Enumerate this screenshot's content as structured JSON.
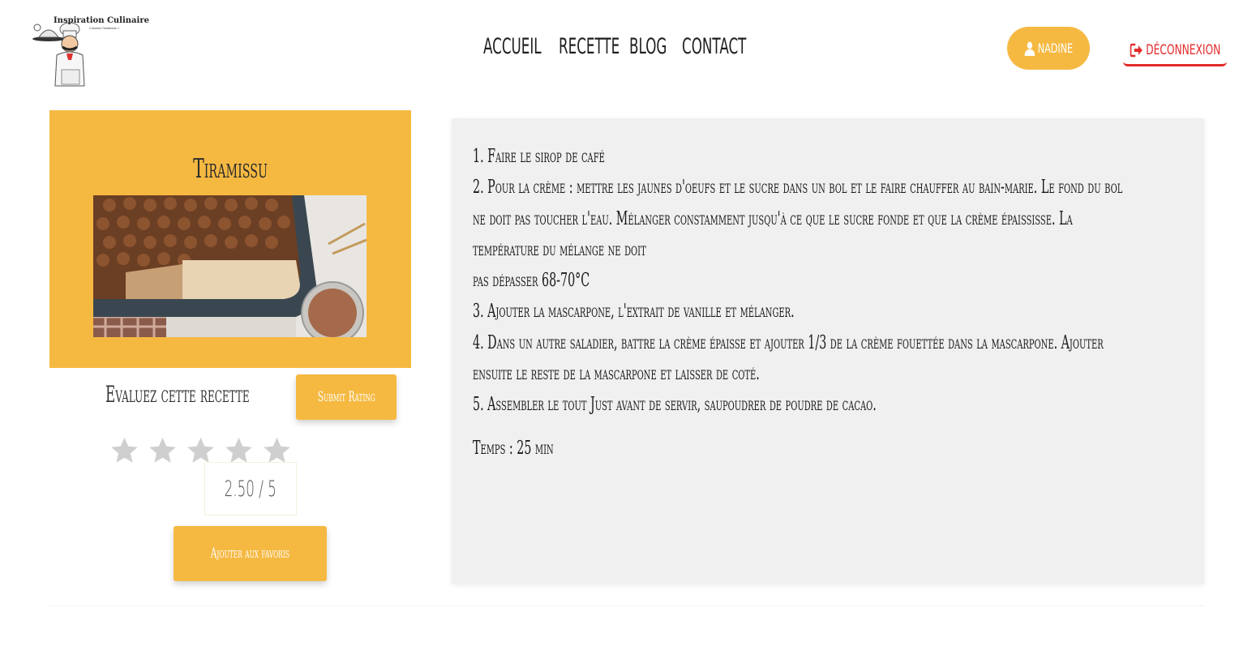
{
  "brand": {
    "name": "Inspiration Culinaire",
    "tagline": "Cuisinez l'inattendu !"
  },
  "nav": {
    "items": [
      {
        "label": "ACCUEIL"
      },
      {
        "label": "RECETTE"
      },
      {
        "label": "BLOG"
      },
      {
        "label": "CONTACT"
      }
    ]
  },
  "user": {
    "name": "NADINE",
    "logout_label": "DÉCONNEXION"
  },
  "recipe": {
    "title": "Tiramissu",
    "rate_prompt": "Evaluez cette recette",
    "submit_label": "Submit Rating",
    "rating": {
      "value": 2.5,
      "max": 5,
      "display": "2.50 / 5"
    },
    "favorite_label": "Ajouter aux favoris",
    "steps": [
      "1. Faire le sirop de café",
      "2. Pour la crème : mettre les jaunes d'oeufs et le sucre dans un bol et le faire chauffer au bain-marie. Le fond du bol",
      "ne doit pas toucher l'eau. Mélanger constamment jusqu'à ce que le sucre fonde et que la crème épaississe. La",
      "température du mélange ne doit",
      "pas dépasser 68-70°C",
      "3. Ajouter la mascarpone, l'extrait de vanille et mélanger.",
      "4. Dans un autre saladier, battre la crème épaisse et ajouter 1/3 de la crème fouettée dans la mascarpone. Ajouter",
      "ensuite le reste de la mascarpone et laisser de coté.",
      "5. Assembler le tout Just avant de servir, saupoudrer de poudre de cacao."
    ],
    "time": "Temps : 25 min"
  },
  "colors": {
    "accent": "#f5b942",
    "danger": "#e32a2a",
    "panel": "#f0f0f0",
    "star_empty": "#cfcfcf"
  }
}
